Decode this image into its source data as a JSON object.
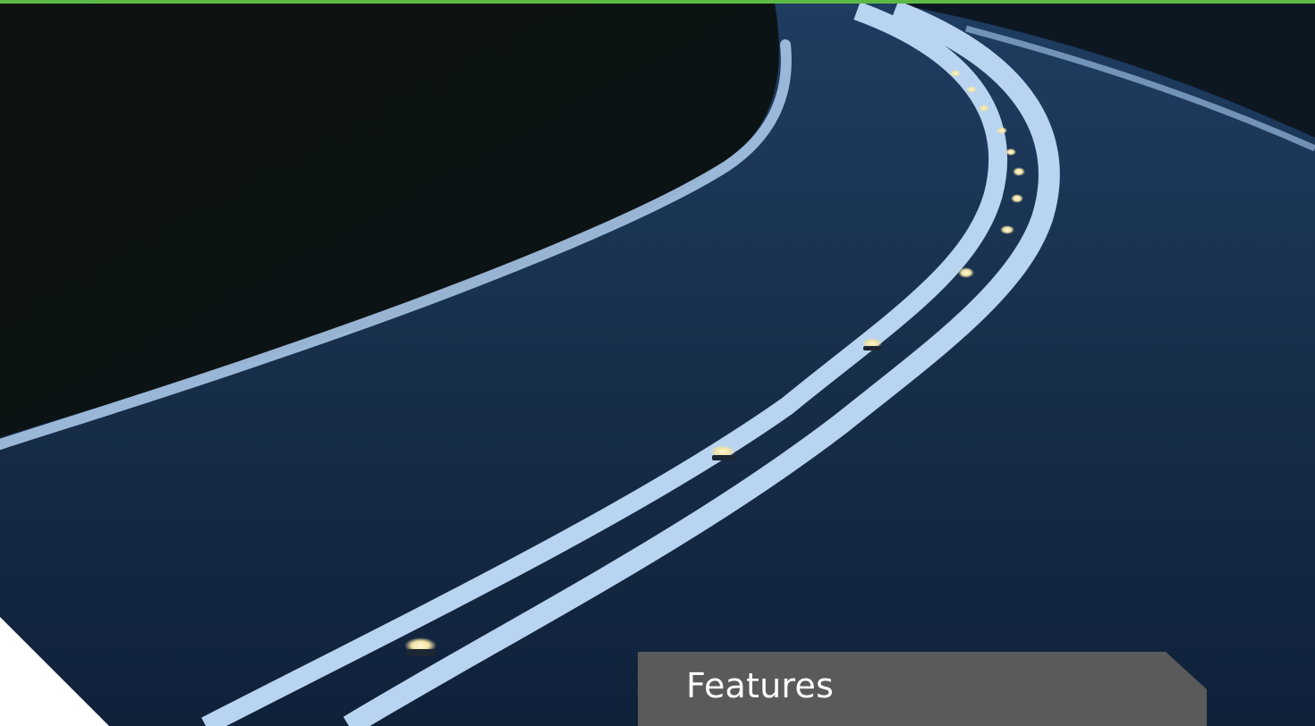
{
  "hero": {
    "image_icon": "night-road-photo"
  },
  "features_tab": {
    "label": "Features"
  },
  "colors": {
    "accent_green": "#5cb946",
    "tab_background": "#5a5a5b",
    "road_dark": "#132235",
    "line_white": "#b9d4f0"
  }
}
